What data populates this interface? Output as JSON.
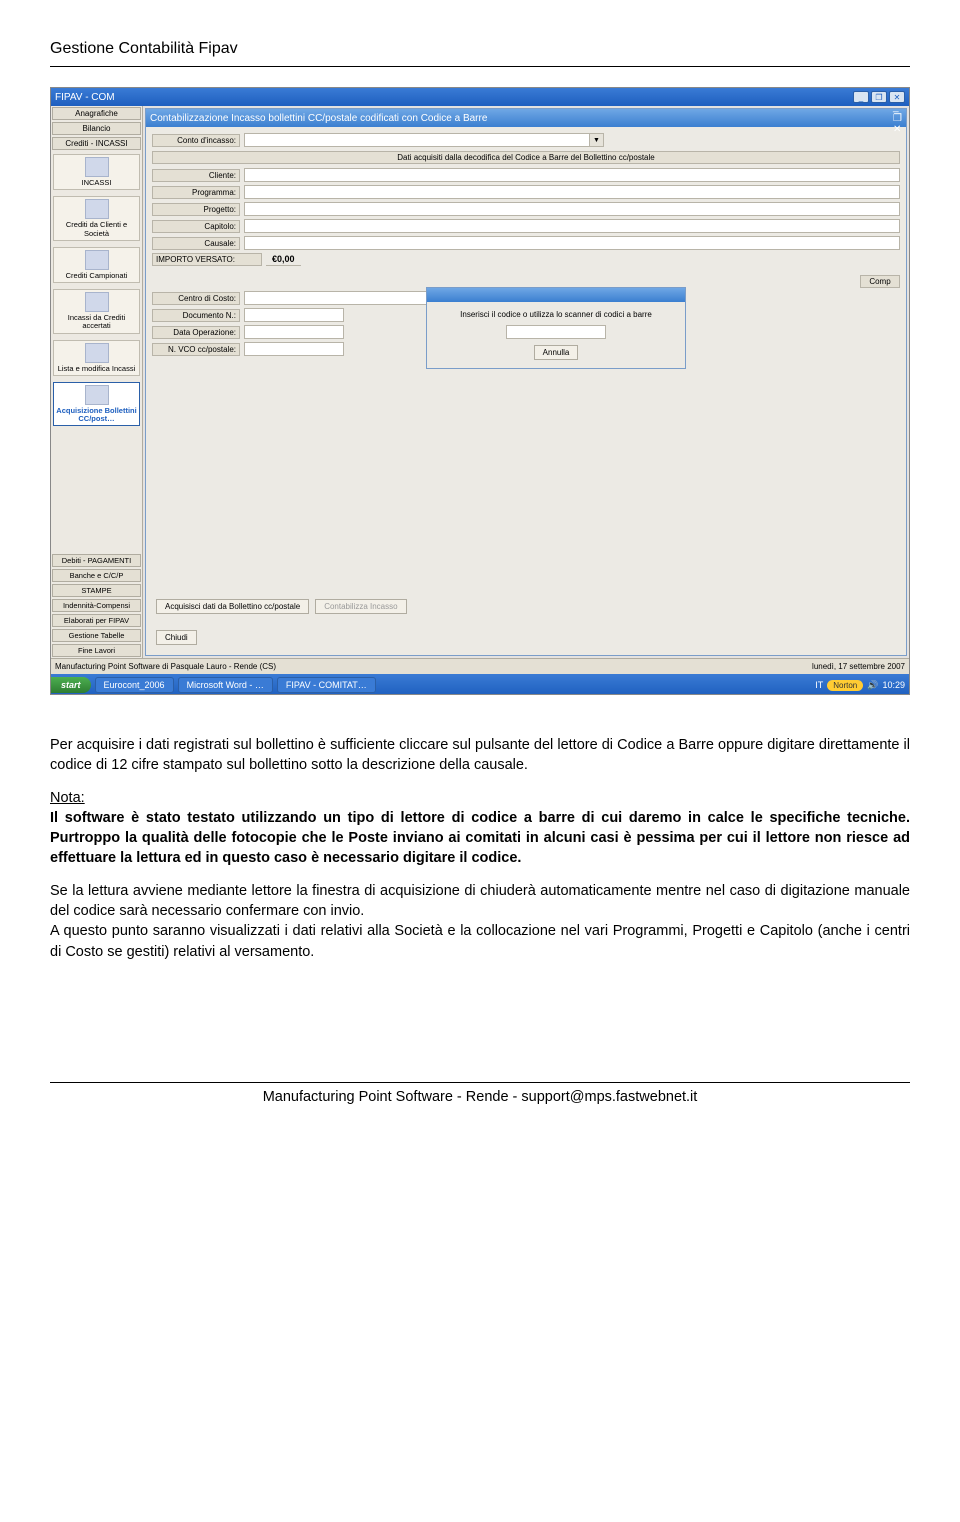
{
  "doc_title": "Gestione Contabilità Fipav",
  "outer_window": {
    "title": "FIPAV - COM"
  },
  "child_window": {
    "title": "Contabilizzazione Incasso bollettini CC/postale codificati con Codice a Barre"
  },
  "sidebar": {
    "heads": [
      "Anagrafiche",
      "Bilancio",
      "Crediti - INCASSI"
    ],
    "items": [
      {
        "label": "INCASSI"
      },
      {
        "label": "Crediti da Clienti e Società"
      },
      {
        "label": "Crediti Campionati"
      },
      {
        "label": "Incassi da Crediti accertati"
      },
      {
        "label": "Lista e modifica Incassi"
      },
      {
        "label": "Acquisizione Bollettini CC/post…",
        "active": true
      }
    ],
    "foots": [
      "Debiti - PAGAMENTI",
      "Banche e C/C/P",
      "STAMPE",
      "Indennità-Compensi",
      "Elaborati per FIPAV",
      "Gestione Tabelle",
      "Fine Lavori"
    ]
  },
  "form": {
    "conto_incasso": "Conto d'incasso:",
    "section_header": "Dati acquisiti dalla decodifica del Codice a Barre del Bollettino cc/postale",
    "cliente": "Cliente:",
    "programma": "Programma:",
    "progetto": "Progetto:",
    "capitolo": "Capitolo:",
    "causale": "Causale:",
    "importo_lbl": "IMPORTO VERSATO:",
    "importo_val": "€0,00",
    "comp": "Comp",
    "centro_costo": "Centro di Costo:",
    "documento": "Documento N.:",
    "data_op": "Data Operazione:",
    "vco": "N. VCO cc/postale:",
    "btn_acquire": "Acquisisci dati da Bollettino cc/postale",
    "btn_contab": "Contabilizza Incasso",
    "btn_close": "Chiudi"
  },
  "modal": {
    "prompt": "Inserisci il codice o utilizza lo scanner di codici a barre",
    "cancel": "Annulla"
  },
  "status": {
    "left": "Manufacturing Point Software di Pasquale Lauro - Rende (CS)",
    "right": "lunedì, 17 settembre 2007"
  },
  "taskbar": {
    "start": "start",
    "tasks": [
      "Eurocont_2006",
      "Microsoft Word - …",
      "FIPAV - COMITAT…"
    ],
    "lang": "IT",
    "norton": "Norton",
    "clock": "10:29"
  },
  "body": {
    "p1": "Per acquisire i dati registrati sul bollettino è sufficiente cliccare sul pulsante del lettore di Codice a Barre oppure digitare direttamente il codice di 12 cifre stampato sul bollettino sotto la descrizione della causale.",
    "note_head": "Nota:",
    "note_body": "Il software è stato testato utilizzando un tipo di lettore di codice a barre di cui daremo in calce le specifiche tecniche. Purtroppo la qualità delle fotocopie che le Poste inviano ai comitati in alcuni casi è pessima per cui il lettore non riesce  ad effettuare la lettura ed in questo caso è necessario digitare il codice.",
    "p3": "Se la lettura avviene mediante lettore la finestra di acquisizione di chiuderà automaticamente mentre nel caso di digitazione manuale del codice sarà necessario confermare con invio.",
    "p4": "A questo punto saranno visualizzati i dati relativi alla Società e la collocazione nel vari Programmi, Progetti e Capitolo (anche i centri di Costo se gestiti) relativi al versamento."
  },
  "footer": "Manufacturing Point Software - Rende - support@mps.fastwebnet.it"
}
